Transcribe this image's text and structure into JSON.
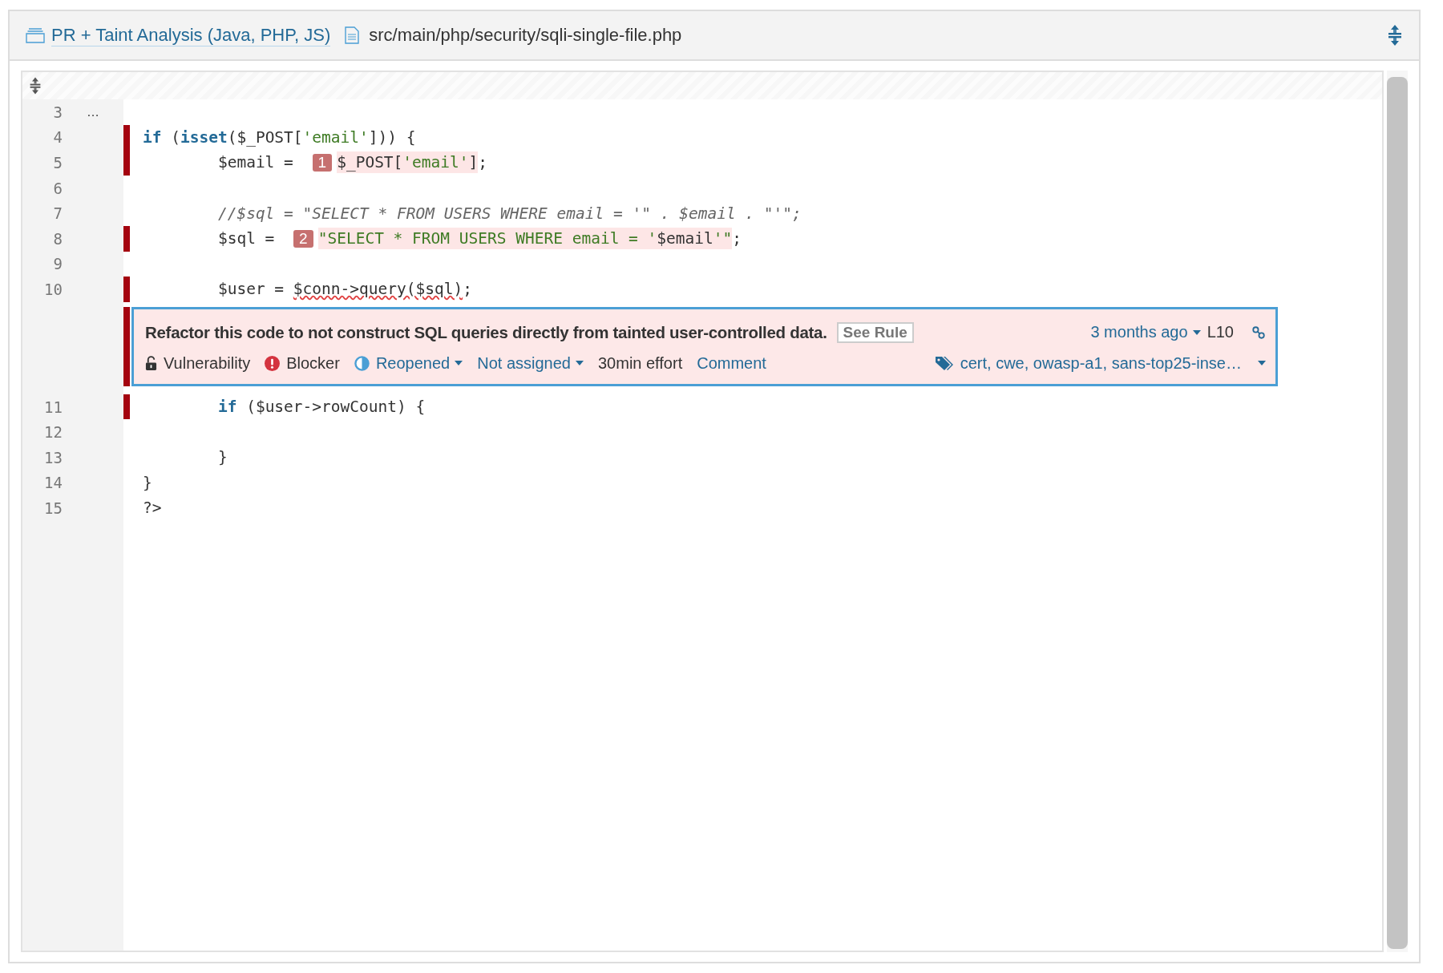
{
  "header": {
    "project": "PR + Taint Analysis (Java, PHP, JS)",
    "file": "src/main/php/security/sqli-single-file.php"
  },
  "lines": [
    {
      "number": "3",
      "marker": false,
      "expand": "…"
    },
    {
      "number": "4",
      "marker": true,
      "segments": [
        {
          "kind": "code",
          "highlighted": false,
          "tokens": [
            {
              "kind": "keyword",
              "text": "if"
            },
            {
              "kind": "plain",
              "text": " ("
            },
            {
              "kind": "keyword",
              "text": "isset"
            },
            {
              "kind": "plain",
              "text": "($_POST["
            },
            {
              "kind": "string",
              "text": "'email'"
            },
            {
              "kind": "plain",
              "text": "])) {"
            }
          ]
        }
      ]
    },
    {
      "number": "5",
      "marker": true,
      "segments": [
        {
          "kind": "code",
          "highlighted": false,
          "tokens": [
            {
              "kind": "plain",
              "text": "        $email = "
            }
          ]
        },
        {
          "kind": "step",
          "text": "1"
        },
        {
          "kind": "code",
          "highlighted": true,
          "tokens": [
            {
              "kind": "plain",
              "text": "$_POST["
            },
            {
              "kind": "string",
              "text": "'email'"
            },
            {
              "kind": "plain",
              "text": "]"
            }
          ]
        },
        {
          "kind": "code",
          "highlighted": false,
          "tokens": [
            {
              "kind": "plain",
              "text": ";"
            }
          ]
        }
      ]
    },
    {
      "number": "6",
      "marker": false
    },
    {
      "number": "7",
      "marker": false,
      "segments": [
        {
          "kind": "code",
          "highlighted": false,
          "tokens": [
            {
              "kind": "comment",
              "text": "        //$sql = \"SELECT * FROM USERS WHERE email = '\" . $email . \"'\";"
            }
          ]
        }
      ]
    },
    {
      "number": "8",
      "marker": true,
      "segments": [
        {
          "kind": "code",
          "highlighted": false,
          "tokens": [
            {
              "kind": "plain",
              "text": "        $sql = "
            }
          ]
        },
        {
          "kind": "step",
          "text": "2"
        },
        {
          "kind": "code",
          "highlighted": true,
          "tokens": [
            {
              "kind": "string",
              "text": "\"SELECT * FROM USERS WHERE email = '"
            },
            {
              "kind": "plain",
              "text": "$email"
            },
            {
              "kind": "string",
              "text": "'\""
            }
          ]
        },
        {
          "kind": "code",
          "highlighted": false,
          "tokens": [
            {
              "kind": "plain",
              "text": ";"
            }
          ]
        }
      ]
    },
    {
      "number": "9",
      "marker": false
    },
    {
      "number": "10",
      "marker": true,
      "segments": [
        {
          "kind": "code",
          "highlighted": false,
          "tokens": [
            {
              "kind": "plain",
              "text": "        $user = "
            },
            {
              "kind": "error",
              "text": "$conn->query($sql)"
            },
            {
              "kind": "plain",
              "text": ";"
            }
          ]
        }
      ],
      "issue": {
        "message": "Refactor this code to not construct SQL queries directly from tainted user-controlled data.",
        "rule_button": "See Rule",
        "age": "3 months ago",
        "line": "L10",
        "type": "Vulnerability",
        "severity": "Blocker",
        "status": "Reopened",
        "assignee": "Not assigned",
        "effort": "30min effort",
        "comment": "Comment",
        "tags": "cert, cwe, owasp-a1, sans-top25-inse…"
      }
    },
    {
      "number": "11",
      "marker": true,
      "segments": [
        {
          "kind": "code",
          "highlighted": false,
          "tokens": [
            {
              "kind": "keyword",
              "text": "        if"
            },
            {
              "kind": "plain",
              "text": " ($user->rowCount) {"
            }
          ]
        }
      ]
    },
    {
      "number": "12",
      "marker": false
    },
    {
      "number": "13",
      "marker": false,
      "segments": [
        {
          "kind": "code",
          "highlighted": false,
          "tokens": [
            {
              "kind": "plain",
              "text": "        }"
            }
          ]
        }
      ]
    },
    {
      "number": "14",
      "marker": false,
      "segments": [
        {
          "kind": "code",
          "highlighted": false,
          "tokens": [
            {
              "kind": "plain",
              "text": "}"
            }
          ]
        }
      ]
    },
    {
      "number": "15",
      "marker": false,
      "segments": [
        {
          "kind": "code",
          "highlighted": false,
          "tokens": [
            {
              "kind": "plain",
              "text": "?>"
            }
          ]
        }
      ]
    }
  ]
}
